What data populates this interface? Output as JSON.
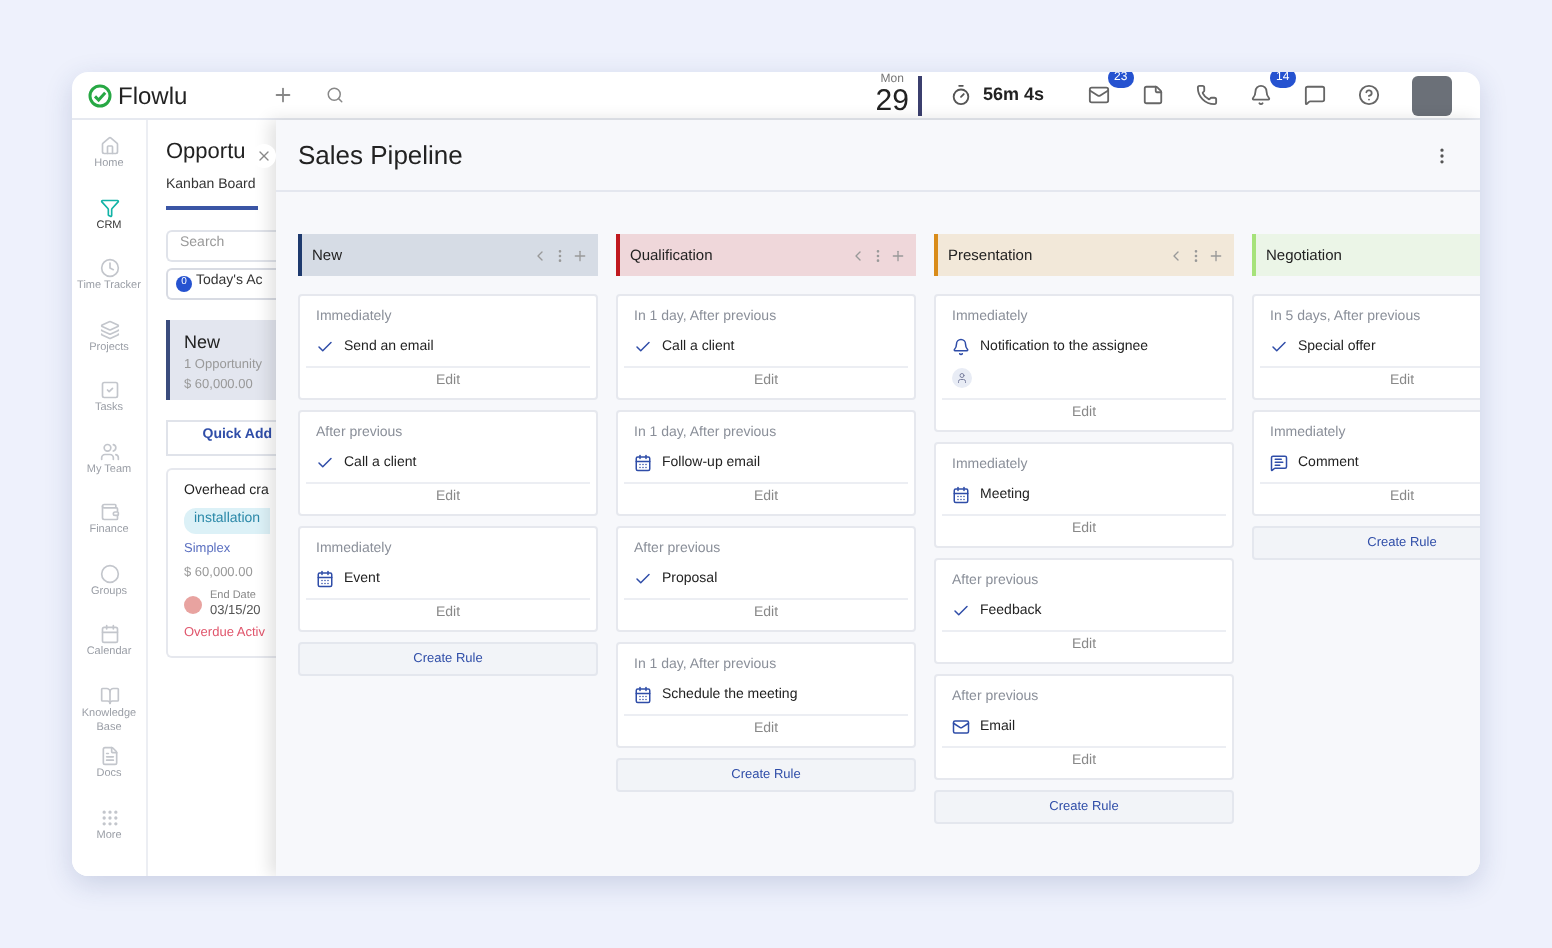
{
  "app": {
    "name": "Flowlu"
  },
  "topbar": {
    "date_day": "Mon",
    "date_num": "29",
    "timer": "56m 4s",
    "mail_badge": "23",
    "bell_badge": "14"
  },
  "sidebar": {
    "items": [
      {
        "label": "Home",
        "selected": false
      },
      {
        "label": "CRM",
        "selected": true
      },
      {
        "label": "Time Tracker",
        "selected": false
      },
      {
        "label": "Projects",
        "selected": false
      },
      {
        "label": "Tasks",
        "selected": false
      },
      {
        "label": "My Team",
        "selected": false
      },
      {
        "label": "Finance",
        "selected": false
      },
      {
        "label": "Groups",
        "selected": false
      },
      {
        "label": "Calendar",
        "selected": false
      },
      {
        "label": "Knowledge Base",
        "selected": false
      },
      {
        "label": "Docs",
        "selected": false
      },
      {
        "label": "More",
        "selected": false
      }
    ]
  },
  "back_panel": {
    "title": "Opportu",
    "tab": "Kanban Board",
    "search_placeholder": "Search",
    "activities_count": "0",
    "activities_label": "Today's Ac",
    "stage": {
      "name": "New",
      "count": "1 Opportunity",
      "amount": "$ 60,000.00"
    },
    "quick_add": "Quick Add",
    "deal": {
      "title": "Overhead cra",
      "tag": "installation",
      "company": "Simplex",
      "amount": "$ 60,000.00",
      "date_label": "End Date",
      "date": "03/15/20",
      "alert": "Overdue Activ"
    }
  },
  "pipeline": {
    "title": "Sales Pipeline",
    "columns": [
      {
        "name": "New",
        "color": "#1e3a6e",
        "rules": [
          {
            "timing": "Immediately",
            "kind": "task",
            "action": "Send an email",
            "assignee": false,
            "edit": "Edit"
          },
          {
            "timing": "After previous",
            "kind": "task",
            "action": "Call a client",
            "assignee": false,
            "edit": "Edit"
          },
          {
            "timing": "Immediately",
            "kind": "event",
            "action": "Event",
            "assignee": false,
            "edit": "Edit"
          }
        ],
        "create": "Create Rule"
      },
      {
        "name": "Qualification",
        "color": "#c0191f",
        "rules": [
          {
            "timing": "In 1 day, After previous",
            "kind": "task",
            "action": "Call a client",
            "assignee": false,
            "edit": "Edit"
          },
          {
            "timing": "In 1 day, After previous",
            "kind": "event",
            "action": "Follow-up email",
            "assignee": false,
            "edit": "Edit"
          },
          {
            "timing": "After previous",
            "kind": "task",
            "action": "Proposal",
            "assignee": false,
            "edit": "Edit"
          },
          {
            "timing": "In 1 day, After previous",
            "kind": "event",
            "action": "Schedule the meeting",
            "assignee": false,
            "edit": "Edit"
          }
        ],
        "create": "Create Rule"
      },
      {
        "name": "Presentation",
        "color": "#d98c1a",
        "rules": [
          {
            "timing": "Immediately",
            "kind": "notification",
            "action": "Notification to the assignee",
            "assignee": true,
            "edit": "Edit"
          },
          {
            "timing": "Immediately",
            "kind": "event",
            "action": "Meeting",
            "assignee": false,
            "edit": "Edit"
          },
          {
            "timing": "After previous",
            "kind": "task",
            "action": "Feedback",
            "assignee": false,
            "edit": "Edit"
          },
          {
            "timing": "After previous",
            "kind": "email",
            "action": "Email",
            "assignee": false,
            "edit": "Edit"
          }
        ],
        "create": "Create Rule"
      },
      {
        "name": "Negotiation",
        "color": "#a6e27a",
        "rules": [
          {
            "timing": "In 5 days, After previous",
            "kind": "task",
            "action": "Special offer",
            "assignee": false,
            "edit": "Edit"
          },
          {
            "timing": "Immediately",
            "kind": "comment",
            "action": "Comment",
            "assignee": false,
            "edit": "Edit"
          }
        ],
        "create": "Create Rule"
      }
    ]
  }
}
